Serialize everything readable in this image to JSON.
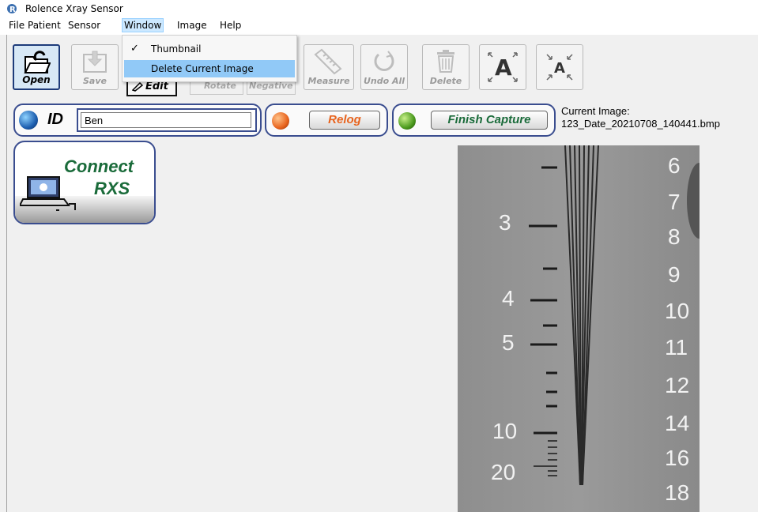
{
  "window": {
    "title": "Rolence Xray Sensor"
  },
  "menu": [
    "File",
    "Patient",
    "Sensor",
    "Window",
    "Image",
    "Help"
  ],
  "window_menu": {
    "items": [
      {
        "label": "Thumbnail",
        "checked": true
      },
      {
        "label": "Delete Current Image",
        "highlighted": true
      }
    ]
  },
  "toolbar": {
    "open": "Open",
    "save": "Save",
    "edit": "Edit",
    "rotate": "Rotate",
    "negative": "Negative",
    "measure": "Measure",
    "undo_all": "Undo All",
    "delete": "Delete"
  },
  "patient": {
    "id_label": "ID",
    "id_value": "Ben",
    "relog": "Relog",
    "finish_capture": "Finish Capture"
  },
  "current_image": {
    "label": "Current Image:",
    "filename": "123_Date_20210708_140441.bmp"
  },
  "connect": {
    "line1": "Connect",
    "line2": "RXS"
  },
  "xray_scale": {
    "left": [
      "3",
      "4",
      "5",
      "10",
      "20"
    ],
    "right": [
      "6",
      "7",
      "8",
      "9",
      "10",
      "11",
      "12",
      "14",
      "16",
      "18"
    ]
  },
  "colors": {
    "accent": "#3a4d8f",
    "relog": "#e8641e",
    "capture": "#1a6b3a",
    "menu_highlight": "#91c9f7"
  }
}
